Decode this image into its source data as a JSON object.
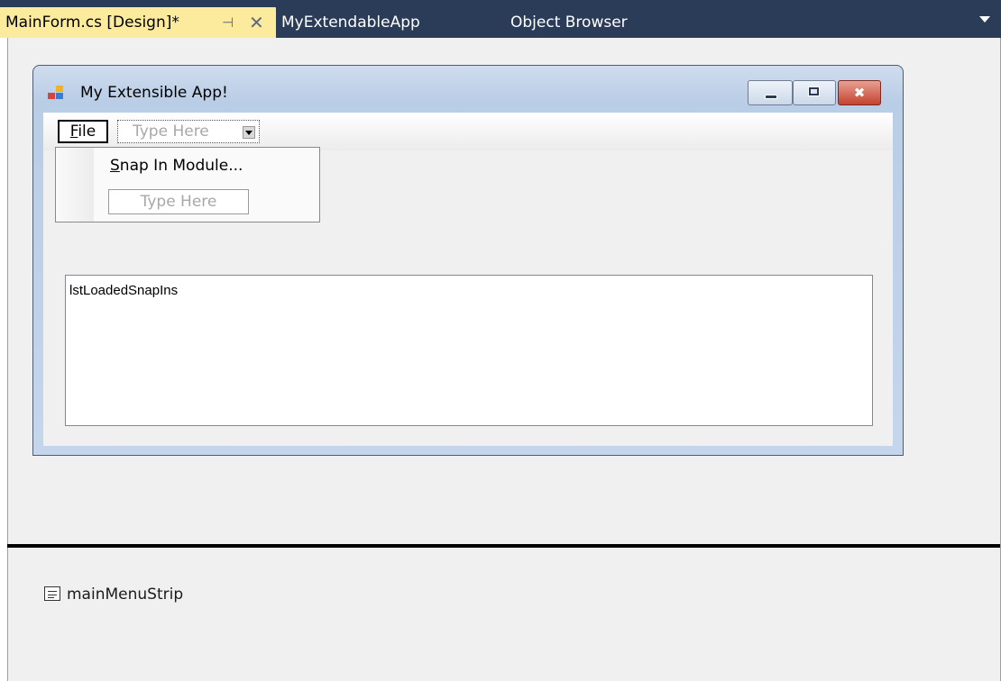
{
  "tabs": {
    "active": {
      "label": "MainForm.cs [Design]*",
      "pin_glyph": "⊣",
      "close_glyph": "✕"
    },
    "second": {
      "label": "MyExtendableApp"
    },
    "third": {
      "label": "Object Browser"
    }
  },
  "form": {
    "title": "My Extensible App!",
    "close_glyph": "✖",
    "menu": {
      "file_label_first": "F",
      "file_label_rest": "ile",
      "type_here": "Type Here"
    },
    "dropdown": {
      "item_first": "S",
      "item_rest": "nap In Module...",
      "type_here": "Type Here"
    },
    "listbox_name": "lstLoadedSnapIns"
  },
  "component_tray": {
    "item_label": "mainMenuStrip",
    "item_icon": "menustrip-icon"
  },
  "colors": {
    "tab_strip": "#2b3c59",
    "active_tab": "#fdeb9d",
    "designer_bg": "#f0f0f0"
  }
}
